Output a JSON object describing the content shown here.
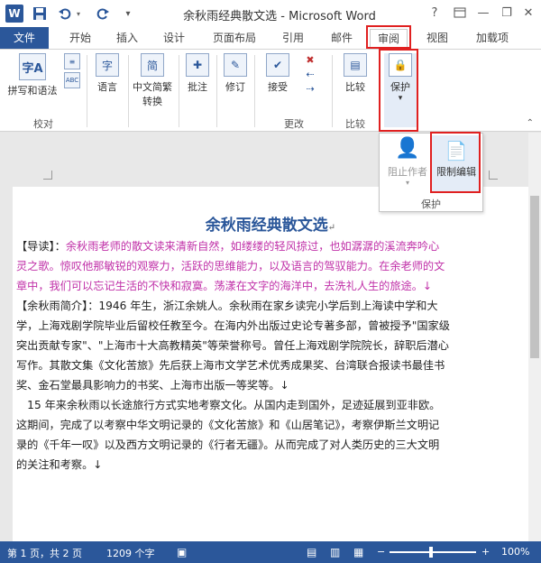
{
  "window": {
    "title": "余秋雨经典散文选 - Microsoft Word",
    "help": "?",
    "minimize": "—",
    "restore": "❐",
    "close": "✕"
  },
  "quick_access": {
    "save_icon": "save-icon",
    "undo_icon": "undo-icon",
    "redo_icon": "redo-icon",
    "customize_icon": "customize-icon"
  },
  "tabs": [
    {
      "label": "文件"
    },
    {
      "label": "开始"
    },
    {
      "label": "插入"
    },
    {
      "label": "设计"
    },
    {
      "label": "页面布局"
    },
    {
      "label": "引用"
    },
    {
      "label": "邮件"
    },
    {
      "label": "审阅"
    },
    {
      "label": "视图"
    },
    {
      "label": "加载项"
    }
  ],
  "ribbon": {
    "spelling": "拼写和语法",
    "language": "语言",
    "chinese_convert_1": "中文简繁",
    "chinese_convert_2": "转换",
    "comment": "批注",
    "track": "修订",
    "accept": "接受",
    "compare": "比较",
    "protect": "保护",
    "group_proofing": "校对",
    "group_changes": "更改",
    "group_compare": "比较"
  },
  "protect_popup": {
    "block_authors": "阻止作者",
    "restrict_editing": "限制编辑",
    "group_label": "保护"
  },
  "document": {
    "title": "余秋雨经典散文选",
    "lines": [
      {
        "prefix": "【导读】：",
        "text": "余秋雨老师的散文读来清新自然，如缕缕的轻风掠过，也如潺潺的溪流奔吟心",
        "pink": true
      },
      {
        "prefix": "",
        "text": "灵之歌。惊叹他那敏锐的观察力，活跃的思维能力，以及语言的驾驭能力。在余老师的文",
        "pink": true
      },
      {
        "prefix": "",
        "text": "章中，我们可以忘记生活的不快和寂寞。荡漾在文字的海洋中，去洗礼人生的旅途。↓",
        "pink": true
      },
      {
        "prefix": "",
        "text": "【余秋雨简介】：1946 年生，浙江余姚人。余秋雨在家乡读完小学后到上海读中学和大",
        "pink": false
      },
      {
        "prefix": "",
        "text": "学，上海戏剧学院毕业后留校任教至今。在海内外出版过史论专著多部，曾被授予\"国家级",
        "pink": false
      },
      {
        "prefix": "",
        "text": "突出贡献专家\"、\"上海市十大高教精英\"等荣誉称号。曾任上海戏剧学院院长，辞职后潜心",
        "pink": false
      },
      {
        "prefix": "",
        "text": "写作。其散文集《文化苦旅》先后获上海市文学艺术优秀成果奖、台湾联合报读书最佳书",
        "pink": false
      },
      {
        "prefix": "",
        "text": "奖、金石堂最具影响力的书奖、上海市出版一等奖等。↓",
        "pink": false
      },
      {
        "prefix": "",
        "text": "　15 年来余秋雨以长途旅行方式实地考察文化。从国内走到国外，足迹延展到亚非欧。",
        "pink": false
      },
      {
        "prefix": "",
        "text": "这期间，完成了以考察中华文明记录的《文化苦旅》和《山居笔记》，考察伊斯兰文明记",
        "pink": false
      },
      {
        "prefix": "",
        "text": "录的《千年一叹》以及西方文明记录的《行者无疆》。从而完成了对人类历史的三大文明",
        "pink": false
      },
      {
        "prefix": "",
        "text": "的关注和考察。↓",
        "pink": false
      }
    ]
  },
  "status": {
    "page": "第 1 页，共 2 页",
    "words": "1209 个字",
    "zoom": "100%"
  }
}
